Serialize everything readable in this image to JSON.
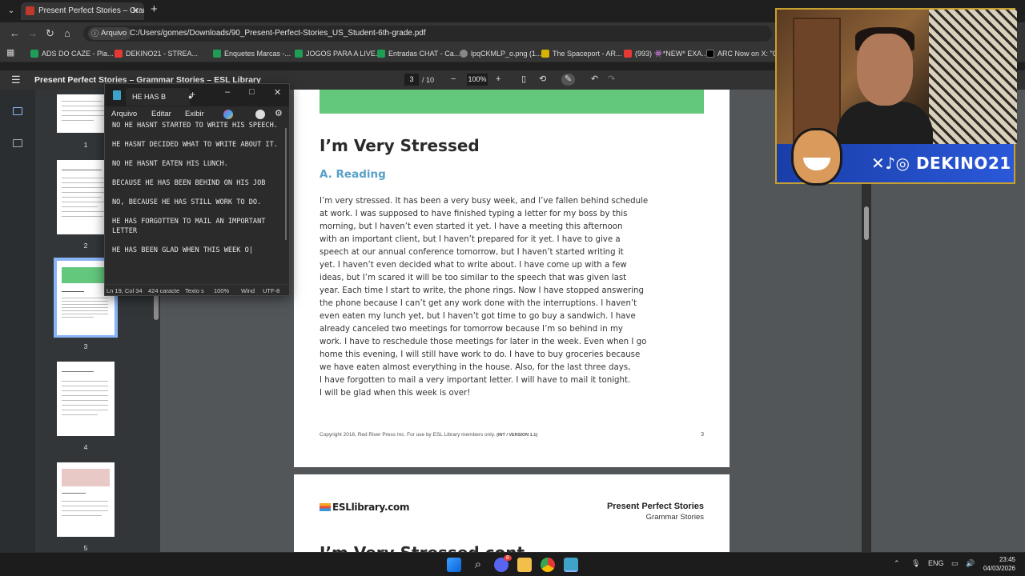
{
  "browser": {
    "tab_title": "Present Perfect Stories – Gramm",
    "tab_close": "✕",
    "new_tab": "+",
    "security_chip": "Arquivo",
    "url": "C:/Users/gomes/Downloads/90_Present-Perfect-Stories_US_Student-6th-grade.pdf",
    "bookmarks": [
      "ADS DO CAZE - Pla...",
      "DEKINO21 - STREA...",
      "Enquetes Marcas -...",
      "JOGOS PARA A LIVE...",
      "Entradas CHAT - Ca...",
      "lpqCKMLP_o.png (1...",
      "The Spaceport - AR...",
      "(993) 👾*NEW* EXA...",
      "ARC Now on X: \"Co..."
    ]
  },
  "pdf": {
    "title": "Present Perfect Stories – Grammar Stories – ESL Library",
    "current_page": "3",
    "total_pages": "/ 10",
    "zoom": "100%",
    "thumbnail_numbers": [
      "1",
      "2",
      "3",
      "4",
      "5"
    ],
    "selected_page": 3,
    "page3": {
      "heading": "I’m Very Stressed",
      "subheading": "A. Reading",
      "lines": [
        "I’m very stressed. It has been a very busy week, and I’ve fallen behind schedule",
        "at work. I was supposed to have finished typing a letter for my boss by this",
        "morning, but I haven’t even started it yet. I have a meeting this afternoon",
        "with an important client, but I haven’t prepared for it yet. I have to give a",
        "speech at our annual conference tomorrow, but I haven’t started writing it",
        "yet. I haven’t even decided what to write about. I have come up with a few",
        "ideas, but I’m scared it will be too similar to the speech that was given last",
        "year. Each time I start to write, the phone rings. Now I have stopped answering",
        "the phone because I can’t get any work done with the interruptions. I haven’t",
        "even eaten my lunch yet, but I haven’t got time to go buy a sandwich. I have",
        "already canceled two meetings for tomorrow because I’m so behind in my",
        "work. I have to reschedule those meetings for later in the week. Even when I go",
        "home this evening, I will still have work to do. I have to buy groceries because",
        "we have eaten almost everything in the house. Also, for the last three days,",
        "I have forgotten to mail a very important letter. I will have to mail it tonight.",
        "I will be glad when this week is over!"
      ],
      "footer": "Copyright 2016, Red River Press Inc. For use by ESL Library members only.",
      "footer_version": "(INT / VERSION 1.1)",
      "page_number": "3"
    },
    "page4": {
      "logo": "ESLlibrary.com",
      "title": "Present Perfect Stories",
      "subtitle": "Grammar Stories",
      "heading": "I’m Very Stressed cont."
    }
  },
  "notepad": {
    "tab_title": "HE HAS B",
    "menu": [
      "Arquivo",
      "Editar",
      "Exibir"
    ],
    "lines": [
      "NO HE HASNT STARTED TO WRITE HIS SPEECH.",
      "HE HASNT DECIDED WHAT TO WRITE ABOUT IT.",
      "NO HE HASNT EATEN HIS LUNCH.",
      "BECAUSE HE HAS BEEN BEHIND ON HIS JOB",
      "NO, BECAUSE HE HAS STILL WORK TO DO.",
      "HE HAS FORGOTTEN TO MAIL AN IMPORTANT LETTER",
      "HE HAS BEEN GLAD WHEN THIS WEEK O|"
    ],
    "status": {
      "position": "Ln 19, Col 34",
      "chars": "424 caracte",
      "format": "Texto s",
      "zoom": "100%",
      "eol": "Wind",
      "encoding": "UTF-8"
    }
  },
  "webcam": {
    "handle": "DEKINO21"
  },
  "taskbar": {
    "language": "ENG",
    "time": "23:45",
    "date": "04/03/2026",
    "badge": "8"
  }
}
